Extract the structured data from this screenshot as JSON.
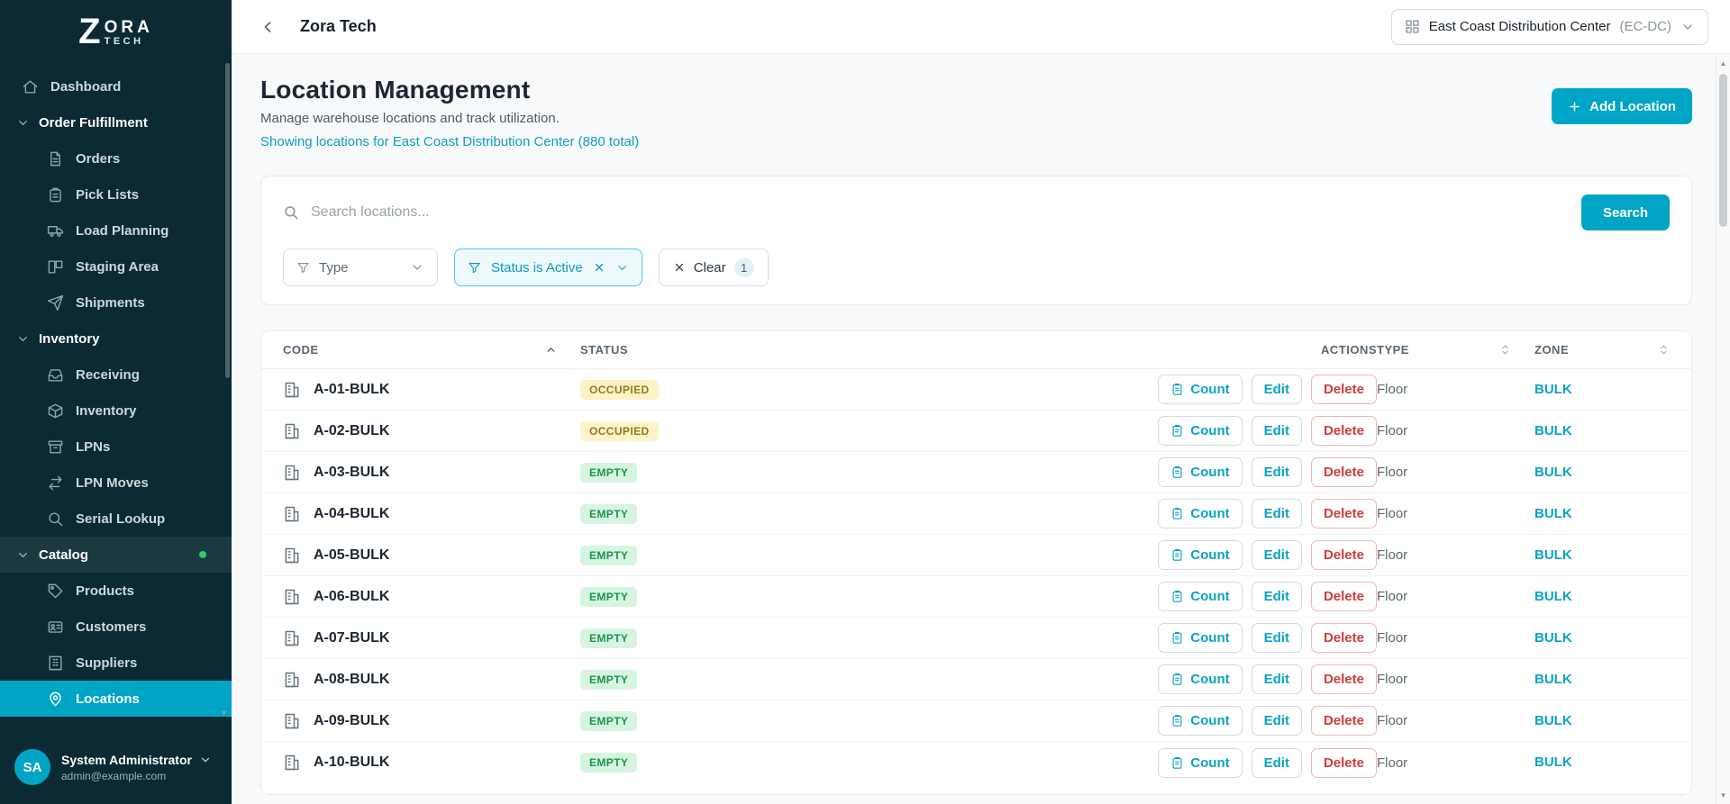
{
  "brand": {
    "z": "Z",
    "ora": "ORA",
    "tech": "TECH"
  },
  "topbar": {
    "title": "Zora Tech",
    "facility": {
      "name": "East Coast Distribution Center",
      "code": "(EC-DC)"
    }
  },
  "sidebar": {
    "nav": [
      {
        "label": "Dashboard",
        "icon": "home",
        "kind": "top"
      },
      {
        "label": "Order Fulfillment",
        "kind": "section"
      },
      {
        "label": "Orders",
        "icon": "document",
        "kind": "sub"
      },
      {
        "label": "Pick Lists",
        "icon": "clipboard",
        "kind": "sub"
      },
      {
        "label": "Load Planning",
        "icon": "truck",
        "kind": "sub"
      },
      {
        "label": "Staging Area",
        "icon": "columns",
        "kind": "sub"
      },
      {
        "label": "Shipments",
        "icon": "send",
        "kind": "sub"
      },
      {
        "label": "Inventory",
        "kind": "section"
      },
      {
        "label": "Receiving",
        "icon": "inbox",
        "kind": "sub"
      },
      {
        "label": "Inventory",
        "icon": "box",
        "kind": "sub"
      },
      {
        "label": "LPNs",
        "icon": "archive",
        "kind": "sub"
      },
      {
        "label": "LPN Moves",
        "icon": "arrows",
        "kind": "sub"
      },
      {
        "label": "Serial Lookup",
        "icon": "search",
        "kind": "sub"
      },
      {
        "label": "Catalog",
        "kind": "section",
        "dot": true
      },
      {
        "label": "Products",
        "icon": "tag",
        "kind": "sub"
      },
      {
        "label": "Customers",
        "icon": "idcard",
        "kind": "sub"
      },
      {
        "label": "Suppliers",
        "icon": "building",
        "kind": "sub"
      },
      {
        "label": "Locations",
        "icon": "pin",
        "kind": "sub",
        "active": true
      }
    ],
    "user": {
      "initials": "SA",
      "name": "System Administrator",
      "email": "admin@example.com"
    }
  },
  "page": {
    "title": "Location Management",
    "subtitle": "Manage warehouse locations and track utilization.",
    "showing": "Showing locations for East Coast Distribution Center (880 total)",
    "add_location": "Add Location"
  },
  "search": {
    "placeholder": "Search locations...",
    "button": "Search"
  },
  "filters": {
    "type": "Type",
    "active_chip": "Status is Active",
    "clear": "Clear",
    "clear_count": "1"
  },
  "table": {
    "columns": {
      "code": "CODE",
      "status": "STATUS",
      "actions": "ACTIONS",
      "type": "TYPE",
      "zone": "ZONE"
    },
    "action_labels": {
      "count": "Count",
      "edit": "Edit",
      "delete": "Delete"
    },
    "rows": [
      {
        "code": "A-01-BULK",
        "status": "OCCUPIED",
        "type": "Floor",
        "zone": "BULK"
      },
      {
        "code": "A-02-BULK",
        "status": "OCCUPIED",
        "type": "Floor",
        "zone": "BULK"
      },
      {
        "code": "A-03-BULK",
        "status": "EMPTY",
        "type": "Floor",
        "zone": "BULK"
      },
      {
        "code": "A-04-BULK",
        "status": "EMPTY",
        "type": "Floor",
        "zone": "BULK"
      },
      {
        "code": "A-05-BULK",
        "status": "EMPTY",
        "type": "Floor",
        "zone": "BULK"
      },
      {
        "code": "A-06-BULK",
        "status": "EMPTY",
        "type": "Floor",
        "zone": "BULK"
      },
      {
        "code": "A-07-BULK",
        "status": "EMPTY",
        "type": "Floor",
        "zone": "BULK"
      },
      {
        "code": "A-08-BULK",
        "status": "EMPTY",
        "type": "Floor",
        "zone": "BULK"
      },
      {
        "code": "A-09-BULK",
        "status": "EMPTY",
        "type": "Floor",
        "zone": "BULK"
      },
      {
        "code": "A-10-BULK",
        "status": "EMPTY",
        "type": "Floor",
        "zone": "BULK"
      }
    ]
  },
  "colors": {
    "accent": "#00a5c5",
    "sidebar_bg": "#0b2a33",
    "link": "#0f9fc0",
    "status_occupied_bg": "#fcf3c8",
    "status_occupied_text": "#97781a",
    "status_empty_bg": "#d7f4e2",
    "status_empty_text": "#18964a",
    "danger": "#d23b3b",
    "green_dot": "#2ecc71"
  }
}
